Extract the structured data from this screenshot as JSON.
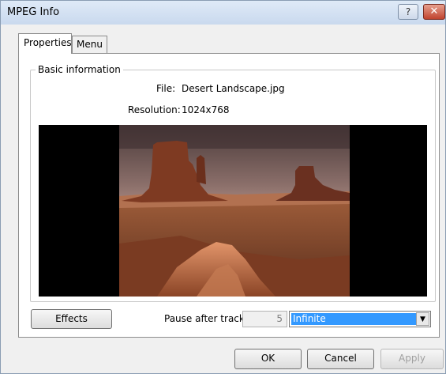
{
  "window": {
    "title": "MPEG Info",
    "help_label": "?",
    "close_label": "✕"
  },
  "tabs": [
    {
      "label": "Properties"
    },
    {
      "label": "Menu"
    }
  ],
  "basic_info": {
    "group_title": "Basic information",
    "file_label": "File:",
    "file_value": "Desert Landscape.jpg",
    "resolution_label": "Resolution:",
    "resolution_value": "1024x768"
  },
  "controls": {
    "effects_button": "Effects",
    "pause_label": "Pause after track:",
    "pause_value": "5",
    "pause_mode": "Infinite"
  },
  "footer": {
    "ok": "OK",
    "cancel": "Cancel",
    "apply": "Apply"
  },
  "icons": {
    "help": "help-icon",
    "close": "close-icon",
    "dropdown": "chevron-down-icon"
  }
}
